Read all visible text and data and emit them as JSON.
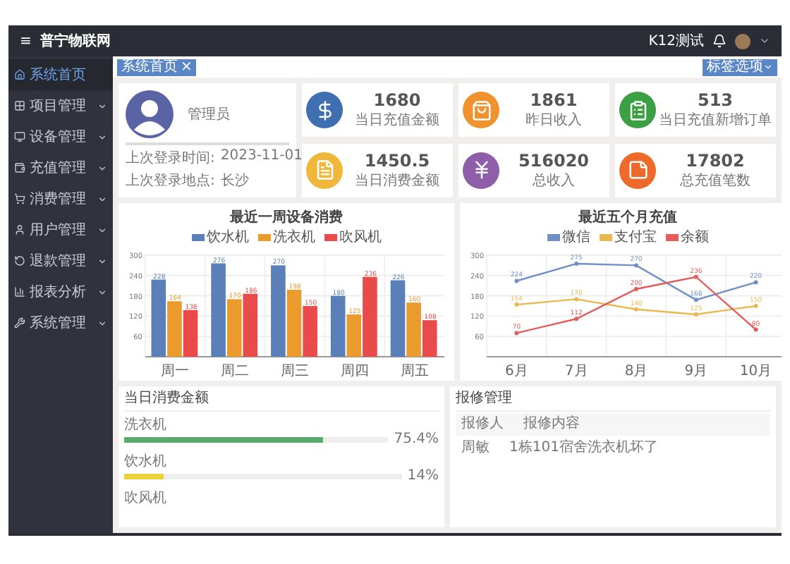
{
  "header": {
    "menu_icon": "≡",
    "title": "普宁物联网",
    "user": "K12测试"
  },
  "sidebar": {
    "items": [
      {
        "label": "系统首页",
        "selected": true,
        "has_submenu": false
      },
      {
        "label": "项目管理",
        "selected": false,
        "has_submenu": true
      },
      {
        "label": "设备管理",
        "selected": false,
        "has_submenu": true
      },
      {
        "label": "充值管理",
        "selected": false,
        "has_submenu": true
      },
      {
        "label": "消费管理",
        "selected": false,
        "has_submenu": true
      },
      {
        "label": "用户管理",
        "selected": false,
        "has_submenu": true
      },
      {
        "label": "退款管理",
        "selected": false,
        "has_submenu": true
      },
      {
        "label": "报表分析",
        "selected": false,
        "has_submenu": true
      },
      {
        "label": "系统管理",
        "selected": false,
        "has_submenu": true
      }
    ]
  },
  "tabs": [
    {
      "label": "系统首页",
      "close": "×",
      "selected": true
    }
  ],
  "tab_options": "标签选项",
  "profile": {
    "role": "管理员",
    "rows": [
      {
        "label": "上次登录时间:",
        "value": "2023-11-01"
      },
      {
        "label": "上次登录地点:",
        "value": "长沙"
      }
    ]
  },
  "stats": [
    {
      "value": "1680",
      "label": "当日充值金额",
      "color": "#3f6fb0"
    },
    {
      "value": "1861",
      "label": "昨日收入",
      "color": "#f0922e"
    },
    {
      "value": "513",
      "label": "当日充值新增订单",
      "color": "#3aa043"
    },
    {
      "value": "1450.5",
      "label": "当日消费金额",
      "color": "#f0b83a"
    },
    {
      "value": "516020",
      "label": "总收入",
      "color": "#8e5ea8"
    },
    {
      "value": "17802",
      "label": "总充值笔数",
      "color": "#ee6a2a"
    }
  ],
  "charts": [
    {
      "chart_data": {
        "type": "bar",
        "title": "最近一周设备消费",
        "grid": true,
        "categories": [
          "周一",
          "周二",
          "周三",
          "周四",
          "周五"
        ],
        "ylim": [
          0,
          300
        ],
        "yticks": [
          60,
          120,
          180,
          240,
          300
        ],
        "data_labels": true,
        "series": [
          {
            "name": "饮水机",
            "color": "#5b7fb8",
            "values": [
              228,
              276,
              270,
              180,
              226
            ]
          },
          {
            "name": "洗衣机",
            "color": "#eb9a2e",
            "values": [
              164,
              170,
              198,
              125,
              160
            ]
          },
          {
            "name": "吹风机",
            "color": "#e94b4b",
            "values": [
              138,
              186,
              150,
              236,
              108
            ]
          }
        ]
      }
    },
    {
      "chart_data": {
        "type": "line",
        "title": "最近五个月充值",
        "grid": true,
        "categories": [
          "6月",
          "7月",
          "8月",
          "9月",
          "10月"
        ],
        "ylim": [
          0,
          300
        ],
        "yticks": [
          60,
          120,
          180,
          240,
          300
        ],
        "data_labels": true,
        "series": [
          {
            "name": "微信",
            "color": "#6f8fc8",
            "marker": "circle",
            "values": [
              224,
              275,
              270,
              168,
              220
            ]
          },
          {
            "name": "支付宝",
            "color": "#eab850",
            "marker": "circle",
            "values": [
              154,
              170,
              140,
              125,
              150
            ]
          },
          {
            "name": "余额",
            "color": "#e55a5a",
            "marker": "circle",
            "values": [
              70,
              112,
              200,
              236,
              80
            ]
          }
        ]
      }
    }
  ],
  "consumption": {
    "title": "当日消费金额",
    "items": [
      {
        "name": "洗衣机",
        "level": 0.754,
        "reading": "75.4%",
        "color": "#5aaa6e"
      },
      {
        "name": "饮水机",
        "level": 0.14,
        "reading": "14%",
        "color": "#ecd23a"
      },
      {
        "name": "吹风机"
      }
    ]
  },
  "repairs": {
    "title": "报修管理",
    "columns": [
      "报修人",
      "报修内容"
    ],
    "rows": [
      [
        "周敏",
        "1栋101宿舍洗衣机坏了"
      ]
    ]
  }
}
